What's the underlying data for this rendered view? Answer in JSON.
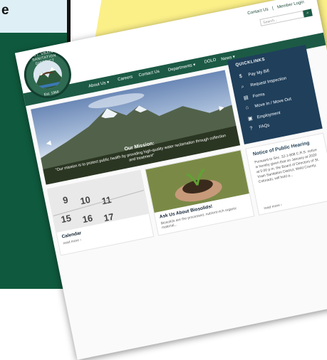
{
  "backdrop": {
    "caption": "e"
  },
  "site": {
    "logo": {
      "ring_text": "ST. VRAIN SANITATION DISTRICT",
      "established": "Est. 1966"
    },
    "top_links": [
      "Contact Us",
      "|",
      "Member Login"
    ],
    "search": {
      "placeholder": "Search...",
      "button": "⌕"
    },
    "nav": [
      "About Us ▾",
      "Careers",
      "Contact Us",
      "Departments ▾",
      "DOLO",
      "News ▾"
    ],
    "hero": {
      "title": "Our Mission:",
      "text": "\"Our mission is to protect public health by providing high-quality water reclamation through collection and treatment\""
    },
    "quicklinks": {
      "title": "QUICKLINKS",
      "items": [
        {
          "icon": "dollar-icon",
          "glyph": "$",
          "label": "Pay My Bill"
        },
        {
          "icon": "search-icon",
          "glyph": "⌕",
          "label": "Request Inspection"
        },
        {
          "icon": "document-icon",
          "glyph": "▤",
          "label": "Forms"
        },
        {
          "icon": "home-icon",
          "glyph": "⌂",
          "label": "Move In / Move Out"
        },
        {
          "icon": "briefcase-icon",
          "glyph": "▣",
          "label": "Employment"
        },
        {
          "icon": "question-icon",
          "glyph": "?",
          "label": "FAQs"
        }
      ]
    },
    "cards": [
      {
        "title": "Calendar",
        "more": "read more ›"
      },
      {
        "title": "Ask Us About Biosolids!",
        "more": "Biosolids are the processed, nutrient-rich organic material..."
      }
    ],
    "notice": {
      "title": "Notice of Public Hearing",
      "text": "Pursuant to Sec. 32-1-808 C.R.S. notice is hereby given that on January at 2020 at 5:00 p.m. the Board of Directors of St. Vrain Sanitation District, Weld County, Colorado, will hold a...",
      "more": "read more ›"
    },
    "colors": {
      "nav_green": "#1c5a45",
      "quicklinks_blue": "#1f3f5b",
      "note_yellow": "#fbef88"
    }
  }
}
